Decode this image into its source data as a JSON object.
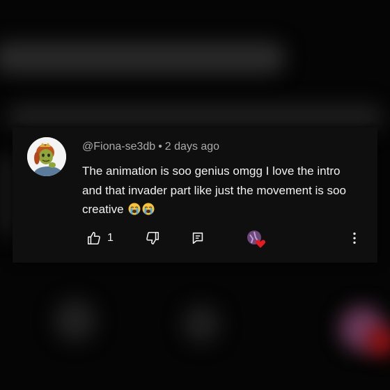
{
  "comment": {
    "author": "@Fiona-se3db",
    "separator": "•",
    "timestamp": "2 days ago",
    "text": "The animation is soo genius omgg I love the intro and that invader part like just the movement is soo creative",
    "emojis": [
      "loudly-crying-face",
      "loudly-crying-face"
    ]
  },
  "actions": {
    "like_count": "1",
    "like_icon": "thumbs-up-icon",
    "dislike_icon": "thumbs-down-icon",
    "reply_icon": "reply-comment-icon",
    "creator_heart_icon": "creator-heart-icon",
    "more_icon": "more-vertical-icon"
  },
  "colors": {
    "card_background": "#0f0f0f",
    "meta_text": "#aaaaaa",
    "body_text": "#f1f1f1",
    "heart": "#e31b23"
  }
}
